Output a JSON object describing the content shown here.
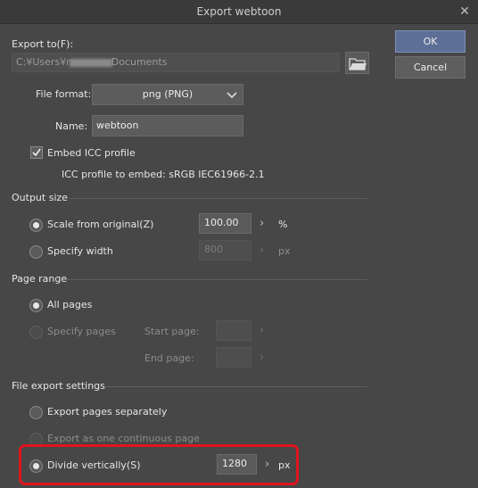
{
  "window": {
    "title": "Export webtoon",
    "close_icon": "close-icon"
  },
  "buttons": {
    "ok": "OK",
    "cancel": "Cancel"
  },
  "export_to": {
    "label": "Export to(F):",
    "path_prefix": "C:¥Users¥r",
    "path_suffix": "Documents",
    "folder_icon": "folder-icon"
  },
  "file_format": {
    "label": "File format:",
    "value": "png (PNG)"
  },
  "name": {
    "label": "Name:",
    "value": "webtoon"
  },
  "icc": {
    "embed_label": "Embed ICC profile",
    "embed_checked": true,
    "profile_text": "ICC profile to embed: sRGB IEC61966-2.1"
  },
  "output_size": {
    "heading": "Output size",
    "scale_label": "Scale from original(Z)",
    "scale_value": "100.00",
    "scale_unit": "%",
    "width_label": "Specify width",
    "width_value": "800",
    "width_unit": "px",
    "selected": "scale"
  },
  "page_range": {
    "heading": "Page range",
    "all_label": "All pages",
    "specify_label": "Specify pages",
    "start_label": "Start page:",
    "end_label": "End page:",
    "selected": "all"
  },
  "file_export": {
    "heading": "File export settings",
    "separately_label": "Export pages separately",
    "continuous_label": "Export as one continuous page",
    "divide_label": "Divide vertically(S)",
    "divide_value": "1280",
    "divide_unit": "px",
    "selected": "divide"
  },
  "colors": {
    "highlight": "#e0141e",
    "primary_button": "#5d6f96"
  }
}
